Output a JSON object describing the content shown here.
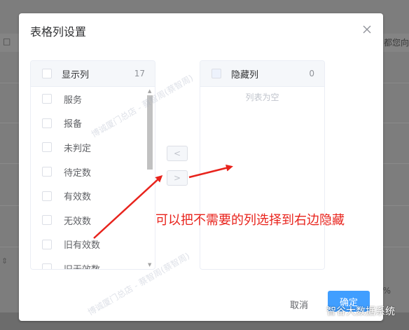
{
  "dialog": {
    "title": "表格列设置"
  },
  "left_panel": {
    "title": "显示列",
    "count": "17",
    "items": [
      "服务",
      "报备",
      "未判定",
      "待定数",
      "有效数",
      "无效数",
      "旧有效数",
      "旧无效数"
    ]
  },
  "right_panel": {
    "title": "隐藏列",
    "count": "0",
    "empty_text": "列表为空"
  },
  "buttons": {
    "move_left": "<",
    "move_right": ">",
    "cancel": "取消",
    "confirm": "确定"
  },
  "annotation": {
    "text": "可以把不需要的列选择到右边隐藏",
    "color": "#e8231c"
  },
  "background": {
    "right_header_text": "都您向",
    "percent_text": "%"
  },
  "watermarks": [
    "博诚厦门总店 - 蔡智周(蔡智周)",
    "博诚厦门总店 - 蔡智周(蔡智周)"
  ],
  "wechat_badge": {
    "text": "智谷大数据系统"
  },
  "colors": {
    "primary": "#409eff",
    "annotation_red": "#e8231c"
  }
}
